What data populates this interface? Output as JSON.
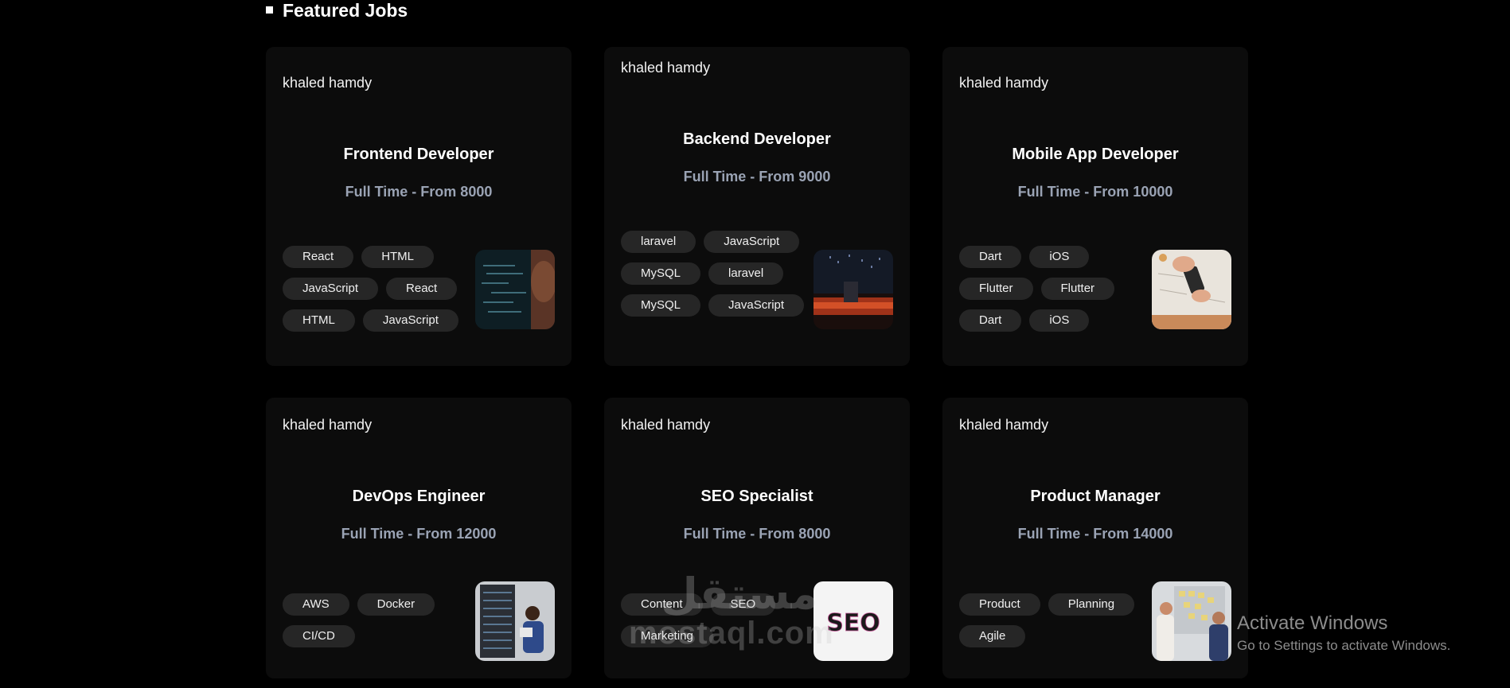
{
  "section": {
    "title": "Featured Jobs"
  },
  "jobs": [
    {
      "company": "khaled hamdy",
      "title": "Frontend Developer",
      "meta": "Full Time - From 8000",
      "tags": [
        "React",
        "HTML",
        "JavaScript",
        "React",
        "HTML",
        "JavaScript"
      ],
      "image": "developer-screen-photo"
    },
    {
      "company": "khaled hamdy",
      "title": "Backend Developer",
      "meta": "Full Time - From 9000",
      "tags": [
        "laravel",
        "JavaScript",
        "MySQL",
        "laravel",
        "MySQL",
        "JavaScript"
      ],
      "image": "night-city-laptop-photo"
    },
    {
      "company": "khaled hamdy",
      "title": "Mobile App Developer",
      "meta": "Full Time - From 10000",
      "tags": [
        "Dart",
        "iOS",
        "Flutter",
        "Flutter",
        "Dart",
        "iOS"
      ],
      "image": "phone-on-desk-photo"
    },
    {
      "company": "khaled hamdy",
      "title": "DevOps Engineer",
      "meta": "Full Time - From 12000",
      "tags": [
        "AWS",
        "Docker",
        "CI/CD"
      ],
      "image": "server-rack-photo"
    },
    {
      "company": "khaled hamdy",
      "title": "SEO Specialist",
      "meta": "Full Time - From 8000",
      "tags": [
        "Content",
        "SEO",
        "Marketing"
      ],
      "image": "seo-letters-photo"
    },
    {
      "company": "khaled hamdy",
      "title": "Product Manager",
      "meta": "Full Time - From 14000",
      "tags": [
        "Product",
        "Planning",
        "Agile"
      ],
      "image": "team-planning-board-photo"
    }
  ],
  "seo_image_text": "SEO",
  "watermark": {
    "arabic": "مستقل",
    "latin": "mostaql.com"
  },
  "os_notice": {
    "title": "Activate Windows",
    "subtitle": "Go to Settings to activate Windows."
  },
  "colors": {
    "background": "#000000",
    "card": "#0c0c0c",
    "tag_bg": "#262626",
    "meta_text": "#9aa3b4"
  }
}
